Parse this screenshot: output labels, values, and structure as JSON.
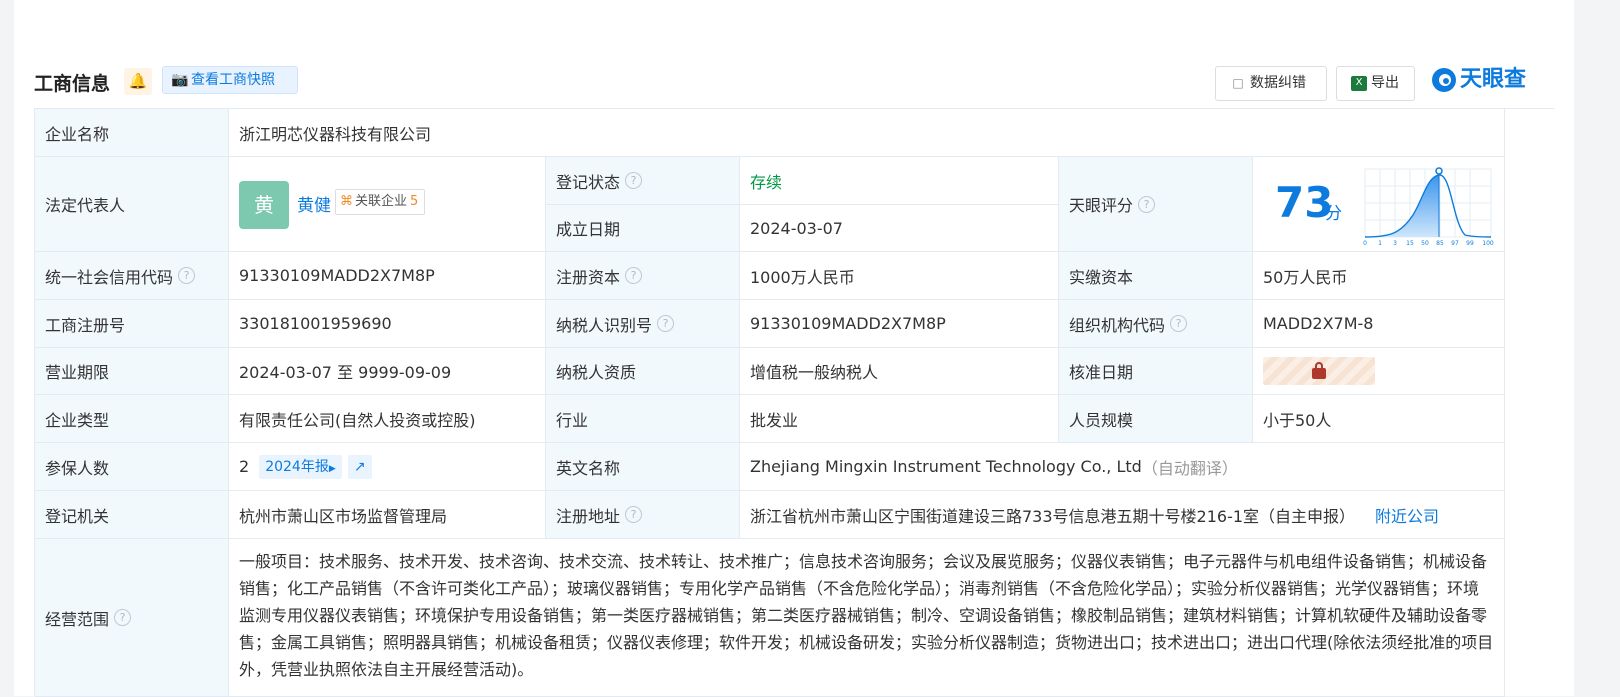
{
  "header": {
    "title": "工商信息",
    "snapshot_label": "查看工商快照",
    "data_fix_label": "数据纠错",
    "export_label": "导出",
    "brand": "天眼查"
  },
  "labels": {
    "company_name": "企业名称",
    "legal_rep": "法定代表人",
    "reg_status": "登记状态",
    "est_date": "成立日期",
    "tianyan_score": "天眼评分",
    "credit_code": "统一社会信用代码",
    "reg_capital": "注册资本",
    "paid_capital": "实缴资本",
    "biz_reg_no": "工商注册号",
    "taxpayer_id": "纳税人识别号",
    "org_code": "组织机构代码",
    "biz_term": "营业期限",
    "taxpayer_qual": "纳税人资质",
    "approval_date": "核准日期",
    "company_type": "企业类型",
    "industry": "行业",
    "staff_size": "人员规模",
    "insured_count": "参保人数",
    "english_name": "英文名称",
    "reg_authority": "登记机关",
    "reg_address": "注册地址",
    "biz_scope": "经营范围"
  },
  "values": {
    "company_name": "浙江明芯仪器科技有限公司",
    "legal_rep_avatar": "黄",
    "legal_rep_name": "黄健",
    "related_label": "关联企业",
    "related_count": "5",
    "reg_status": "存续",
    "est_date": "2024-03-07",
    "score": "73",
    "score_unit": "分",
    "score_ticks": [
      "0",
      "1",
      "3",
      "15",
      "50",
      "85",
      "97",
      "99",
      "100"
    ],
    "credit_code": "91330109MADD2X7M8P",
    "reg_capital": "1000万人民币",
    "paid_capital": "50万人民币",
    "biz_reg_no": "330181001959690",
    "taxpayer_id": "91330109MADD2X7M8P",
    "org_code": "MADD2X7M-8",
    "biz_term": "2024-03-07 至 9999-09-09",
    "taxpayer_qual": "增值税一般纳税人",
    "company_type": "有限责任公司(自然人投资或控股)",
    "industry": "批发业",
    "staff_size": "小于50人",
    "insured_count": "2",
    "report_tag": "2024年报",
    "english_name": "Zhejiang Mingxin Instrument Technology Co., Ltd",
    "auto_translate": "（自动翻译）",
    "reg_authority": "杭州市萧山区市场监督管理局",
    "reg_address": "浙江省杭州市萧山区宁围街道建设三路733号信息港五期十号楼216-1室（自主申报）",
    "nearby_link": "附近公司",
    "biz_scope": "一般项目：技术服务、技术开发、技术咨询、技术交流、技术转让、技术推广；信息技术咨询服务；会议及展览服务；仪器仪表销售；电子元器件与机电组件设备销售；机械设备销售；化工产品销售（不含许可类化工产品）；玻璃仪器销售；专用化学产品销售（不含危险化学品）；消毒剂销售（不含危险化学品）；实验分析仪器销售；光学仪器销售；环境监测专用仪器仪表销售；环境保护专用设备销售；第一类医疗器械销售；第二类医疗器械销售；制冷、空调设备销售；橡胶制品销售；建筑材料销售；计算机软硬件及辅助设备零售；金属工具销售；照明器具销售；机械设备租赁；仪器仪表修理；软件开发；机械设备研发；实验分析仪器制造；货物进出口；技术进出口；进出口代理(除依法须经批准的项目外，凭营业执照依法自主开展经营活动)。"
  },
  "colors": {
    "accent": "#0d7bde",
    "status_green": "#009944",
    "label_bg": "#f2f9fc",
    "avatar_bg": "#7cc9b0"
  },
  "icons": {
    "bell": "bell-icon",
    "camera": "camera-icon",
    "help": "question-circle-icon",
    "lock": "lock-icon",
    "trend": "trend-chart-icon",
    "brand": "tianyancha-eye-logo"
  }
}
